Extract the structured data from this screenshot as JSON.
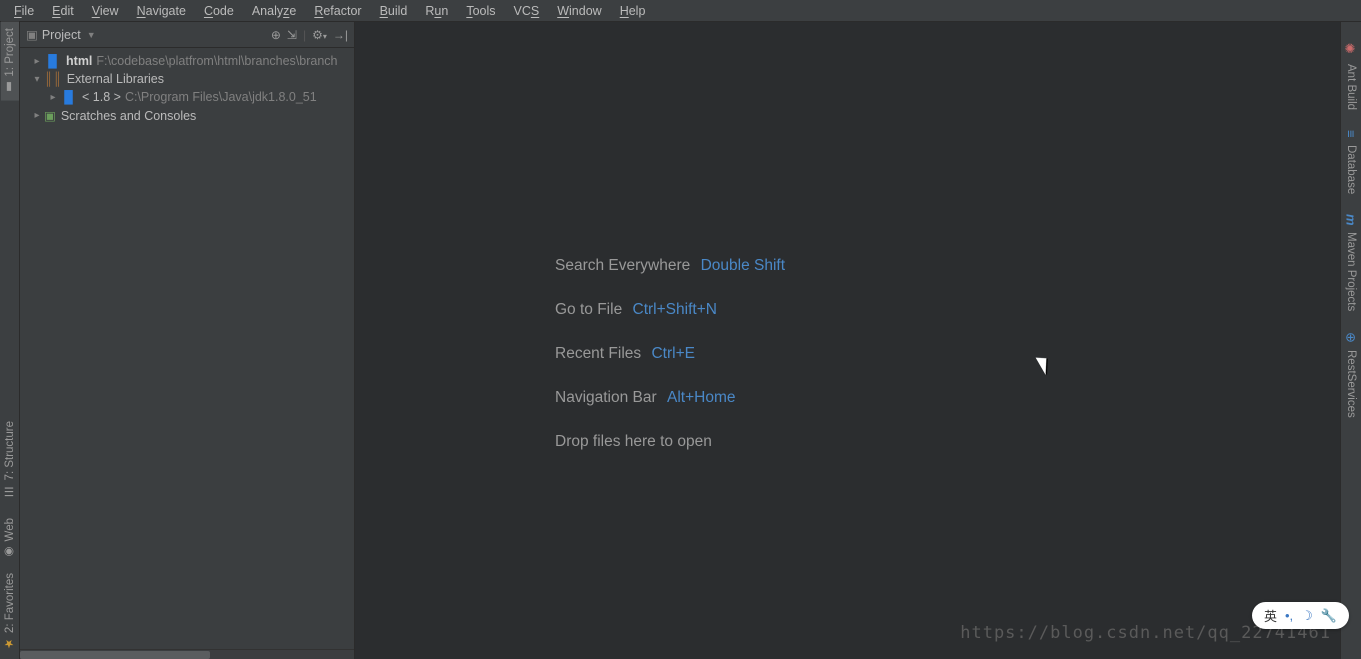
{
  "menu": {
    "items": [
      "File",
      "Edit",
      "View",
      "Navigate",
      "Code",
      "Analyze",
      "Refactor",
      "Build",
      "Run",
      "Tools",
      "VCS",
      "Window",
      "Help"
    ]
  },
  "left_tools": [
    {
      "label": "1: Project",
      "icon": "project-icon",
      "active": true
    },
    {
      "label": "7: Structure",
      "icon": "structure-icon",
      "active": false
    },
    {
      "label": "Web",
      "icon": "web-icon",
      "active": false
    },
    {
      "label": "2: Favorites",
      "icon": "favorites-icon",
      "active": false
    }
  ],
  "right_tools": [
    {
      "label": "Ant Build",
      "icon": "ant-icon"
    },
    {
      "label": "Database",
      "icon": "database-icon"
    },
    {
      "label": "Maven Projects",
      "icon": "maven-icon"
    },
    {
      "label": "RestServices",
      "icon": "rest-icon"
    }
  ],
  "project_panel": {
    "title": "Project",
    "toolbar_icons": [
      "target-icon",
      "collapse-icon",
      "divider-icon",
      "gear-icon",
      "hide-icon"
    ],
    "tree": [
      {
        "level": 0,
        "expand": "closed",
        "icon": "module",
        "name": "html",
        "path": "F:\\codebase\\platfrom\\html\\branches\\branch",
        "bold": true
      },
      {
        "level": 0,
        "expand": "open",
        "icon": "lib",
        "name": "External Libraries",
        "path": "",
        "bold": false
      },
      {
        "level": 1,
        "expand": "closed",
        "icon": "jdk",
        "name": "< 1.8 >",
        "path": "C:\\Program Files\\Java\\jdk1.8.0_51",
        "bold": false
      },
      {
        "level": 0,
        "expand": "closed",
        "icon": "scratch",
        "name": "Scratches and Consoles",
        "path": "",
        "bold": false
      }
    ]
  },
  "editor_hints": [
    {
      "label": "Search Everywhere",
      "shortcut": "Double Shift"
    },
    {
      "label": "Go to File",
      "shortcut": "Ctrl+Shift+N"
    },
    {
      "label": "Recent Files",
      "shortcut": "Ctrl+E"
    },
    {
      "label": "Navigation Bar",
      "shortcut": "Alt+Home"
    },
    {
      "label": "Drop files here to open",
      "shortcut": ""
    }
  ],
  "watermark": "https://blog.csdn.net/qq_22741461",
  "ime": {
    "mode": "英",
    "dots": "•,",
    "moon": "☽",
    "wrench": "🔧"
  }
}
